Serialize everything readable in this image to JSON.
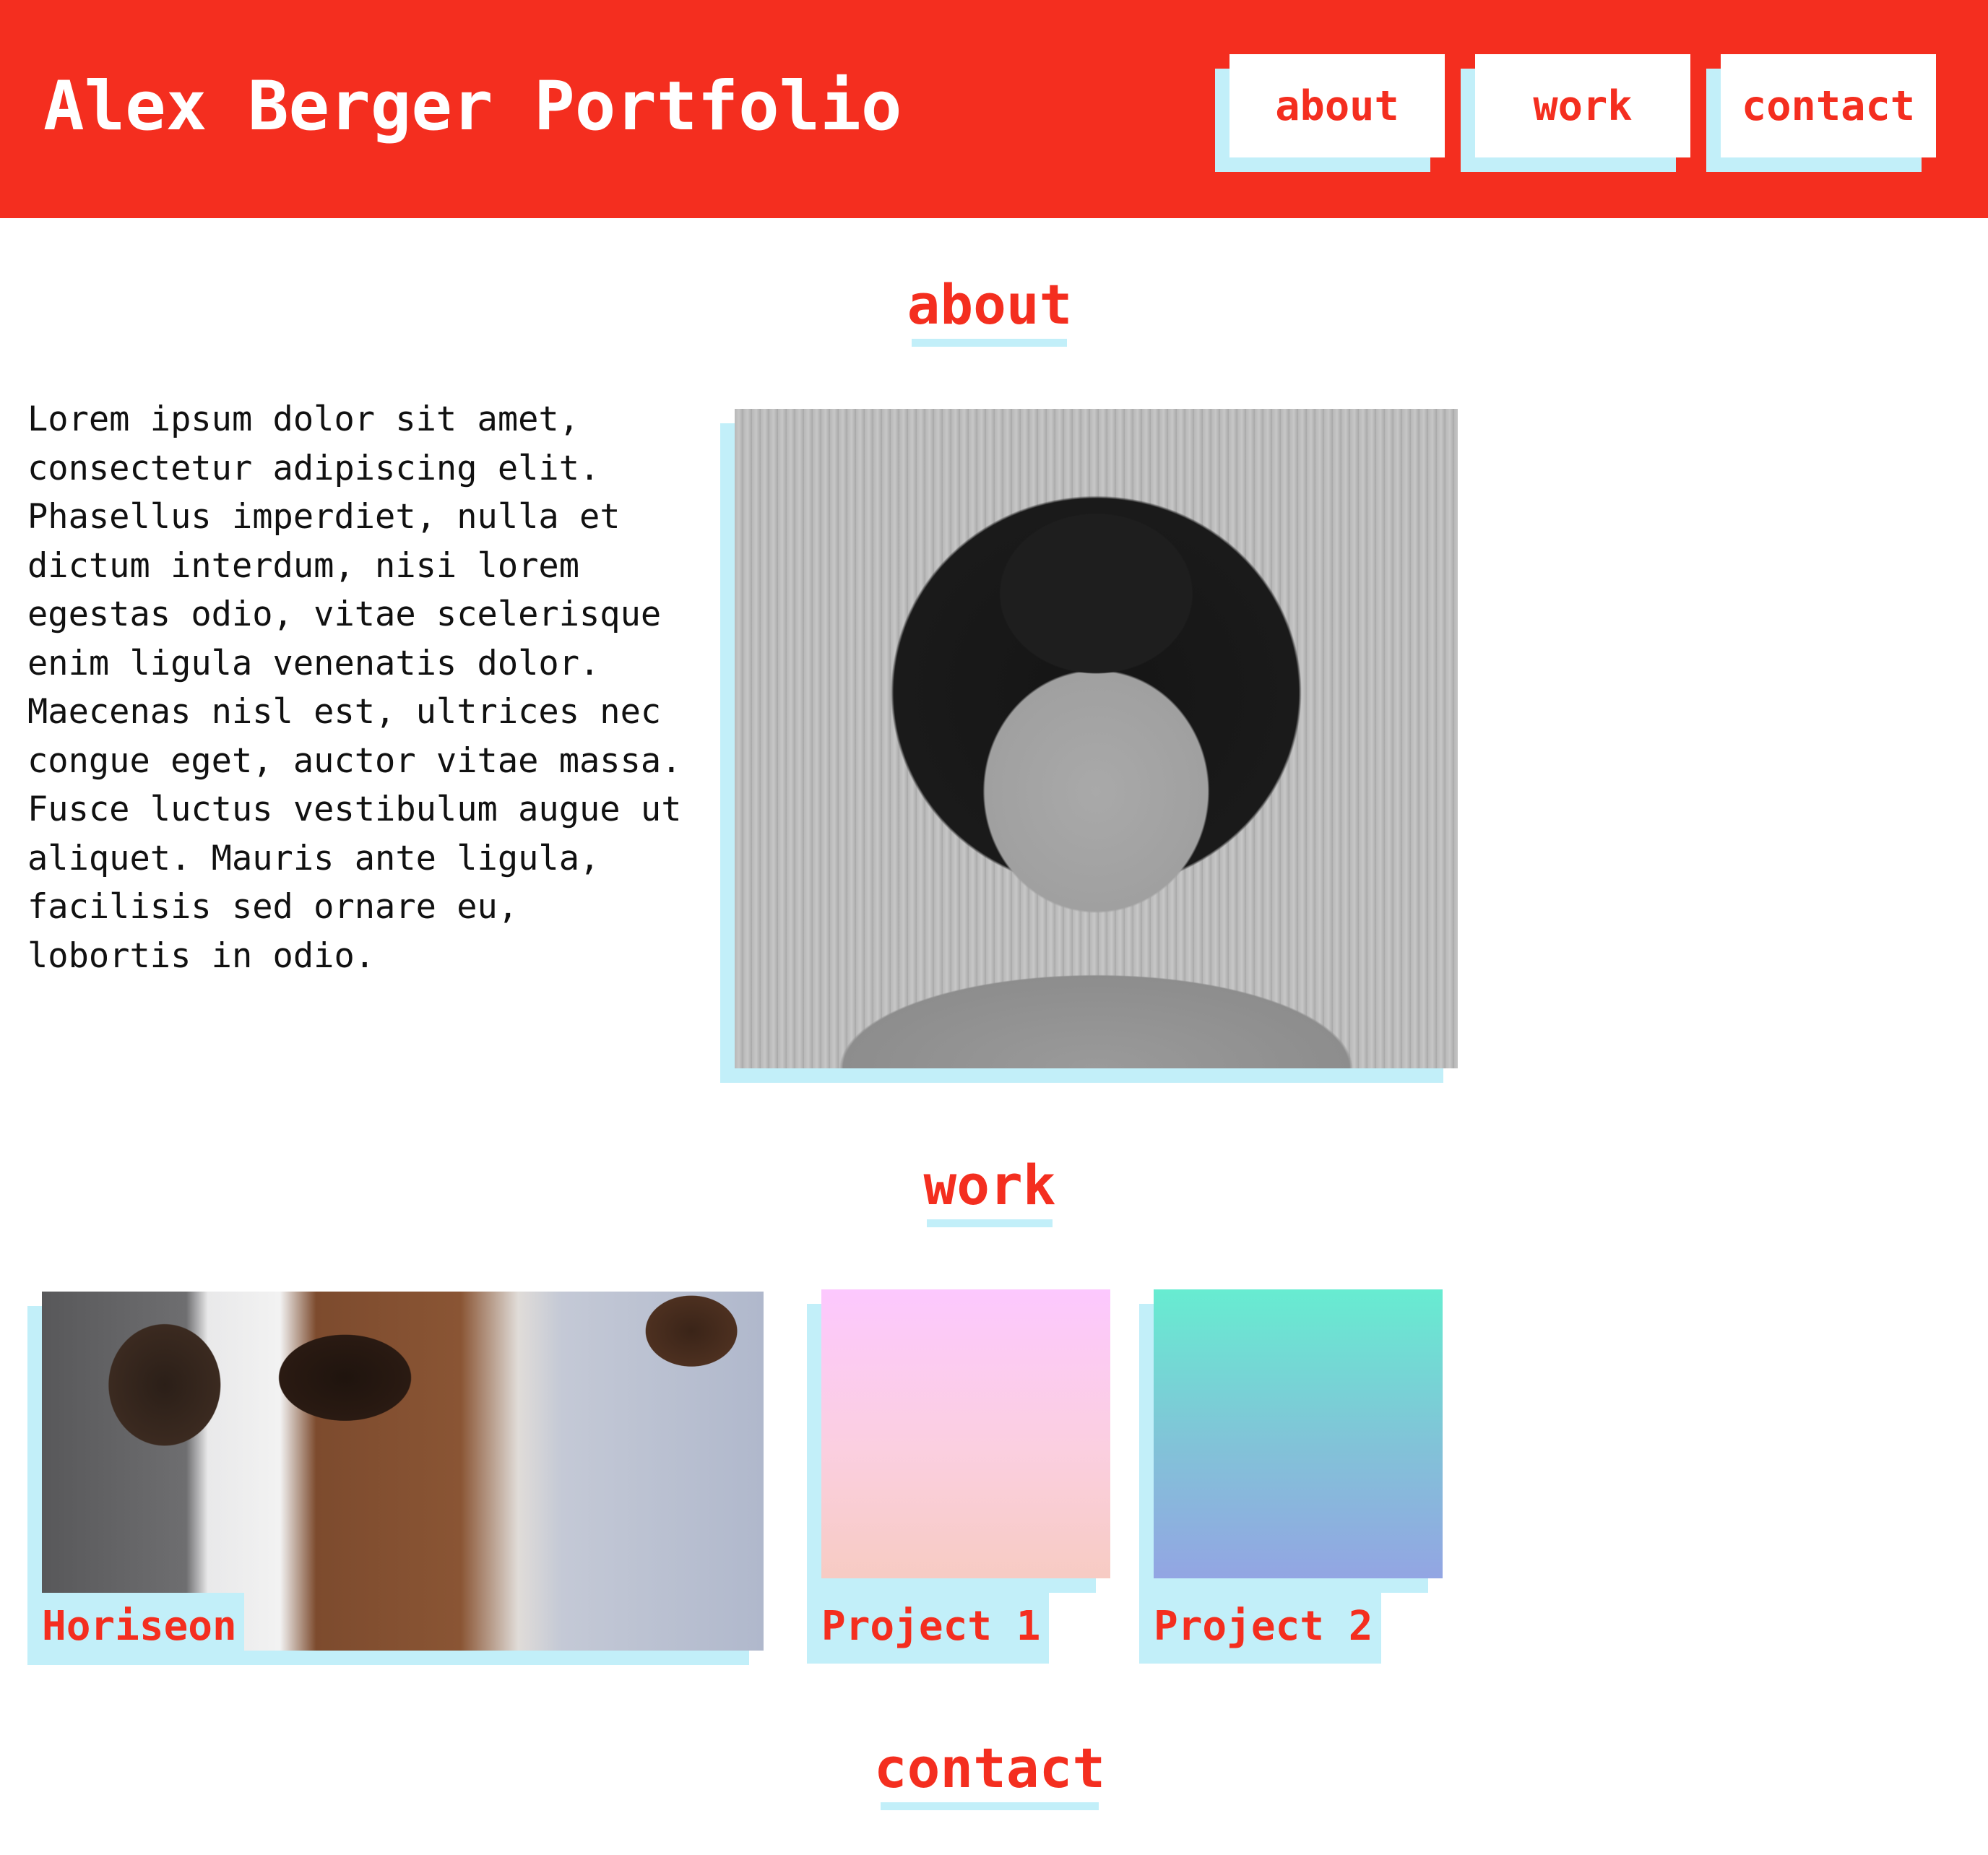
{
  "header": {
    "title": "Alex Berger Portfolio",
    "nav": [
      "about",
      "work",
      "contact"
    ]
  },
  "about": {
    "heading": "about",
    "text": "Lorem ipsum dolor sit amet, consectetur adipiscing elit. Phasellus imperdiet, nulla et dictum interdum, nisi lorem egestas odio, vitae scelerisque enim ligula venenatis dolor. Maecenas nisl est, ultrices nec congue eget, auctor vitae massa. Fusce luctus vestibulum augue ut aliquet. Mauris ante ligula, facilisis sed ornare eu, lobortis in odio."
  },
  "work": {
    "heading": "work",
    "projects": [
      {
        "label": "Horiseon"
      },
      {
        "label": "Project 1"
      },
      {
        "label": "Project 2"
      }
    ]
  },
  "contact": {
    "heading": "contact"
  },
  "colors": {
    "brand_red": "#f42e1f",
    "accent_light_blue": "#c2eff9",
    "text": "#111111",
    "background": "#ffffff"
  }
}
